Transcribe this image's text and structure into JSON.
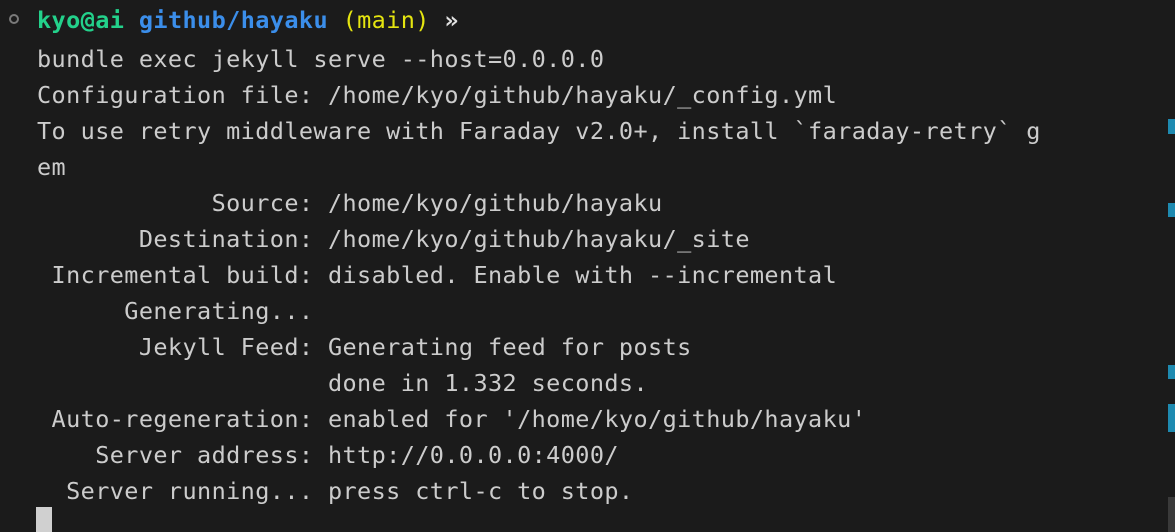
{
  "prompt": {
    "user_host": "kyo@ai",
    "path": "github/hayaku",
    "branch": "(main)",
    "symbol": "»",
    "colors": {
      "user_host": "#23d18b",
      "path": "#3b8eea",
      "branch": "#e5e510",
      "symbol": "#e0e0e0"
    }
  },
  "command": "bundle exec jekyll serve --host=0.0.0.0",
  "output_lines": [
    "Configuration file: /home/kyo/github/hayaku/_config.yml",
    "To use retry middleware with Faraday v2.0+, install `faraday-retry` g",
    "em",
    "            Source: /home/kyo/github/hayaku",
    "       Destination: /home/kyo/github/hayaku/_site",
    " Incremental build: disabled. Enable with --incremental",
    "      Generating...",
    "       Jekyll Feed: Generating feed for posts",
    "                    done in 1.332 seconds.",
    " Auto-regeneration: enabled for '/home/kyo/github/hayaku'",
    "    Server address: http://0.0.0.0:4000/",
    "  Server running... press ctrl-c to stop."
  ]
}
